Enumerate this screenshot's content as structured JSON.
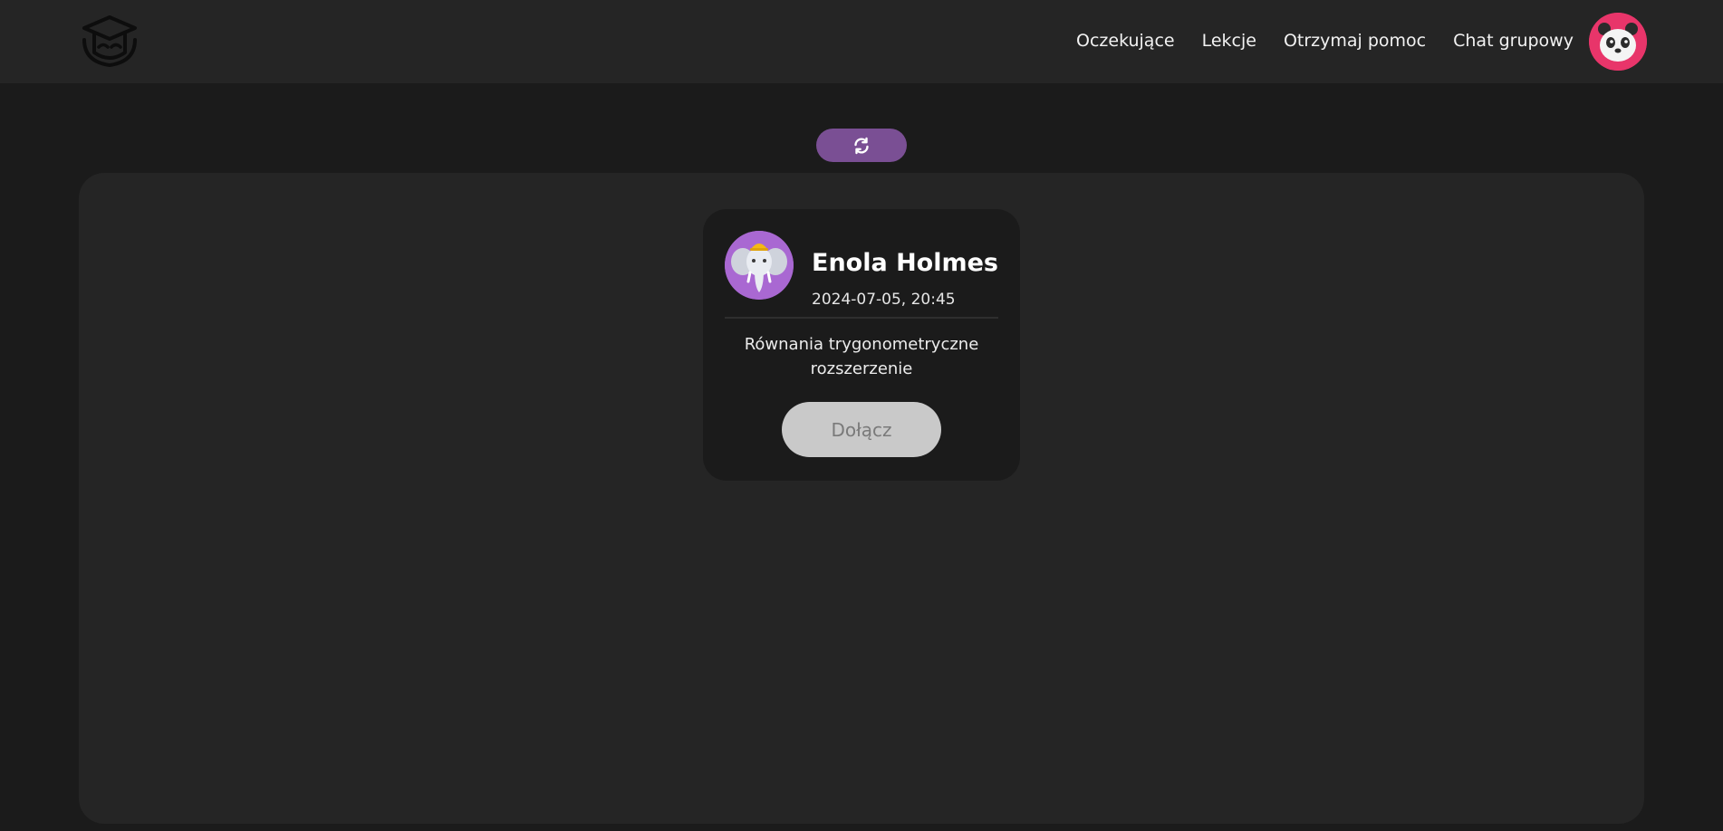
{
  "header": {
    "logo_icon": "graduation-cap-logo-icon",
    "nav": [
      {
        "label": "Oczekujące"
      },
      {
        "label": "Lekcje"
      },
      {
        "label": "Otrzymaj pomoc"
      },
      {
        "label": "Chat grupowy"
      }
    ],
    "user_avatar_icon": "panda-avatar-icon"
  },
  "toolbar": {
    "refresh_icon": "refresh-icon",
    "accent_color": "#7a4f94"
  },
  "lesson_card": {
    "avatar_icon": "elephant-avatar-icon",
    "name": "Enola Holmes",
    "datetime": "2024-07-05, 20:45",
    "topic": "Równania trygonometryczne rozszerzenie",
    "join_label": "Dołącz"
  },
  "colors": {
    "background": "#1b1b1b",
    "surface": "#252525",
    "avatar_pink": "#e8356a",
    "avatar_purple": "#a968d2",
    "button_disabled": "#c9c9c9"
  }
}
